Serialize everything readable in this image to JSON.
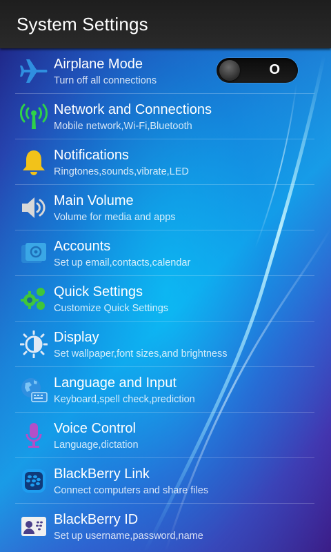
{
  "header": {
    "title": "System Settings"
  },
  "colors": {
    "airplane_icon": "#2f8fe0",
    "network_icon": "#2ed14a",
    "notification_icon": "#f2c21a",
    "volume_icon": "#d8d8d8",
    "accounts_icon": "#3aa7e6",
    "quick_settings_icon": "#3fc63a",
    "display_icon": "#dfe9f5",
    "language_icon": "#2f8fe0",
    "voice_icon": "#b24fc8",
    "bb_link_icon": "#1e9ef0",
    "bb_id_icon": "#f0f0f0"
  },
  "settings": {
    "items": [
      {
        "label": "Airplane Mode",
        "sub": "Turn off all connections",
        "icon": "airplane-icon",
        "toggle": {
          "state_label": "O",
          "on": false
        }
      },
      {
        "label": "Network and Connections",
        "sub": "Mobile network,Wi-Fi,Bluetooth",
        "icon": "antenna-icon"
      },
      {
        "label": "Notifications",
        "sub": "Ringtones,sounds,vibrate,LED",
        "icon": "bell-icon"
      },
      {
        "label": "Main Volume",
        "sub": "Volume for media and apps",
        "icon": "speaker-icon"
      },
      {
        "label": "Accounts",
        "sub": "Set up email,contacts,calendar",
        "icon": "accounts-icon"
      },
      {
        "label": "Quick Settings",
        "sub": "Customize Quick Settings",
        "icon": "gears-icon"
      },
      {
        "label": "Display",
        "sub": "Set wallpaper,font sizes,and brightness",
        "icon": "brightness-icon"
      },
      {
        "label": "Language and Input",
        "sub": "Keyboard,spell check,prediction",
        "icon": "globe-keyboard-icon"
      },
      {
        "label": "Voice Control",
        "sub": "Language,dictation",
        "icon": "microphone-icon"
      },
      {
        "label": "BlackBerry Link",
        "sub": "Connect computers and share files",
        "icon": "blackberry-link-icon"
      },
      {
        "label": "BlackBerry ID",
        "sub": "Set up username,password,name",
        "icon": "id-card-icon"
      }
    ]
  }
}
